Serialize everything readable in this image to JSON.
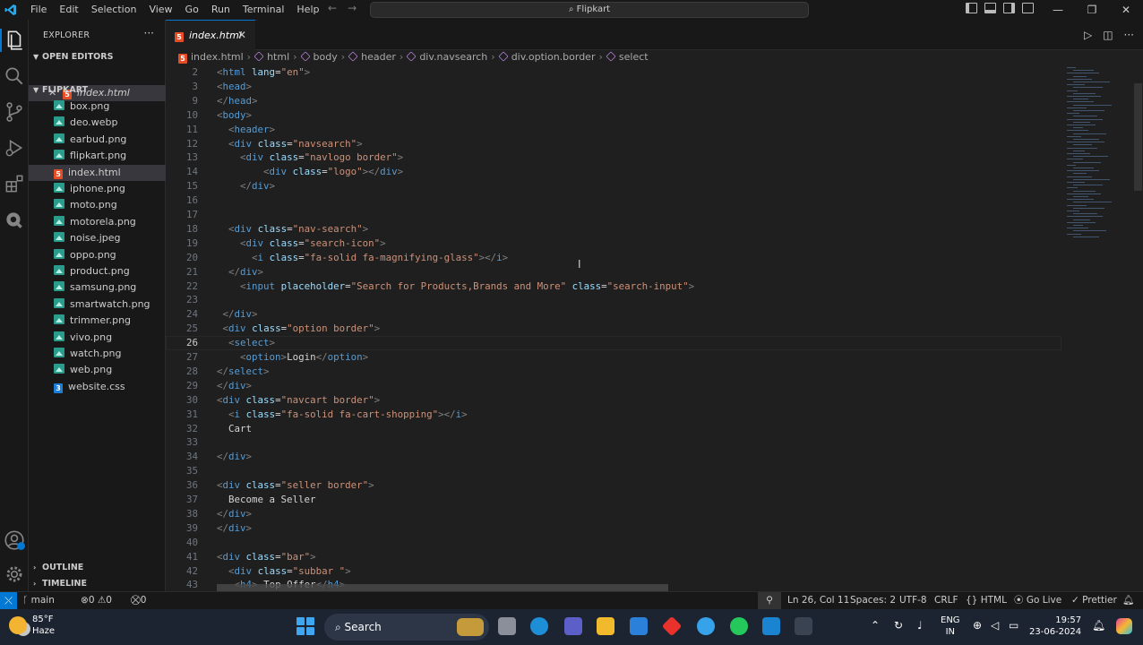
{
  "menu": [
    "File",
    "Edit",
    "Selection",
    "View",
    "Go",
    "Run",
    "Terminal",
    "Help"
  ],
  "command_center": "Flipkart",
  "sidebar": {
    "title": "EXPLORER",
    "open_editors_label": "OPEN EDITORS",
    "open_editor_file": "index.html",
    "folder_label": "FLIPKART",
    "files": [
      {
        "name": "box.png",
        "type": "img"
      },
      {
        "name": "deo.webp",
        "type": "img"
      },
      {
        "name": "earbud.png",
        "type": "img"
      },
      {
        "name": "flipkart.png",
        "type": "img"
      },
      {
        "name": "index.html",
        "type": "html"
      },
      {
        "name": "iphone.png",
        "type": "img"
      },
      {
        "name": "moto.png",
        "type": "img"
      },
      {
        "name": "motorela.png",
        "type": "img"
      },
      {
        "name": "noise.jpeg",
        "type": "img"
      },
      {
        "name": "oppo.png",
        "type": "img"
      },
      {
        "name": "product.png",
        "type": "img"
      },
      {
        "name": "samsung.png",
        "type": "img"
      },
      {
        "name": "smartwatch.png",
        "type": "img"
      },
      {
        "name": "trimmer.png",
        "type": "img"
      },
      {
        "name": "vivo.png",
        "type": "img"
      },
      {
        "name": "watch.png",
        "type": "img"
      },
      {
        "name": "web.png",
        "type": "img"
      },
      {
        "name": "website.css",
        "type": "css"
      }
    ],
    "outline_label": "OUTLINE",
    "timeline_label": "TIMELINE"
  },
  "tab": {
    "label": "index.html"
  },
  "breadcrumb": [
    "index.html",
    "html",
    "body",
    "header",
    "div.navsearch",
    "div.option.border",
    "select"
  ],
  "code_lines": [
    {
      "n": "2",
      "html": "<span class='t'>&lt;</span><span class='tag'>html</span> <span class='at'>lang</span><span class='tx'>=</span><span class='st'>\"en\"</span><span class='t'>&gt;</span>"
    },
    {
      "n": "3",
      "html": "<span class='t'>&lt;</span><span class='tag'>head</span><span class='t'>&gt;</span>"
    },
    {
      "n": "9",
      "html": "<span class='t'>&lt;/</span><span class='tag'>head</span><span class='t'>&gt;</span>"
    },
    {
      "n": "10",
      "html": "<span class='t'>&lt;</span><span class='tag'>body</span><span class='t'>&gt;</span>"
    },
    {
      "n": "11",
      "html": "  <span class='t'>&lt;</span><span class='tag'>header</span><span class='t'>&gt;</span>"
    },
    {
      "n": "12",
      "html": "  <span class='t'>&lt;</span><span class='tag'>div</span> <span class='at'>class</span><span class='tx'>=</span><span class='st'>\"navsearch\"</span><span class='t'>&gt;</span>"
    },
    {
      "n": "13",
      "html": "    <span class='t'>&lt;</span><span class='tag'>div</span> <span class='at'>class</span><span class='tx'>=</span><span class='st'>\"navlogo border\"</span><span class='t'>&gt;</span>"
    },
    {
      "n": "14",
      "html": "        <span class='t'>&lt;</span><span class='tag'>div</span> <span class='at'>class</span><span class='tx'>=</span><span class='st'>\"logo\"</span><span class='t'>&gt;&lt;/</span><span class='tag'>div</span><span class='t'>&gt;</span>"
    },
    {
      "n": "15",
      "html": "    <span class='t'>&lt;/</span><span class='tag'>div</span><span class='t'>&gt;</span>"
    },
    {
      "n": "16",
      "html": ""
    },
    {
      "n": "17",
      "html": ""
    },
    {
      "n": "18",
      "html": "  <span class='t'>&lt;</span><span class='tag'>div</span> <span class='at'>class</span><span class='tx'>=</span><span class='st'>\"nav-search\"</span><span class='t'>&gt;</span>"
    },
    {
      "n": "19",
      "html": "    <span class='t'>&lt;</span><span class='tag'>div</span> <span class='at'>class</span><span class='tx'>=</span><span class='st'>\"search-icon\"</span><span class='t'>&gt;</span>"
    },
    {
      "n": "20",
      "html": "      <span class='t'>&lt;</span><span class='tag'>i</span> <span class='at'>class</span><span class='tx'>=</span><span class='st'>\"fa-solid fa-magnifying-glass\"</span><span class='t'>&gt;&lt;/</span><span class='tag'>i</span><span class='t'>&gt;</span>"
    },
    {
      "n": "21",
      "html": "  <span class='t'>&lt;/</span><span class='tag'>div</span><span class='t'>&gt;</span>"
    },
    {
      "n": "22",
      "html": "    <span class='t'>&lt;</span><span class='tag'>input</span> <span class='at'>placeholder</span><span class='tx'>=</span><span class='st'>\"Search for Products,Brands and More\"</span> <span class='at'>class</span><span class='tx'>=</span><span class='st'>\"search-input\"</span><span class='t'>&gt;</span>"
    },
    {
      "n": "23",
      "html": ""
    },
    {
      "n": "24",
      "html": " <span class='t'>&lt;/</span><span class='tag'>div</span><span class='t'>&gt;</span>"
    },
    {
      "n": "25",
      "html": " <span class='t'>&lt;</span><span class='tag'>div</span> <span class='at'>class</span><span class='tx'>=</span><span class='st'>\"option border\"</span><span class='t'>&gt;</span>"
    },
    {
      "n": "26",
      "html": "  <span class='t'>&lt;</span><span class='tag'>select</span><span class='t'>&gt;</span>"
    },
    {
      "n": "27",
      "html": "    <span class='t'>&lt;</span><span class='tag'>option</span><span class='t'>&gt;</span><span class='tx'>Login</span><span class='t'>&lt;/</span><span class='tag'>option</span><span class='t'>&gt;</span>"
    },
    {
      "n": "28",
      "html": "<span class='t'>&lt;/</span><span class='tag'>select</span><span class='t'>&gt;</span>"
    },
    {
      "n": "29",
      "html": "<span class='t'>&lt;/</span><span class='tag'>div</span><span class='t'>&gt;</span>"
    },
    {
      "n": "30",
      "html": "<span class='t'>&lt;</span><span class='tag'>div</span> <span class='at'>class</span><span class='tx'>=</span><span class='st'>\"navcart border\"</span><span class='t'>&gt;</span>"
    },
    {
      "n": "31",
      "html": "  <span class='t'>&lt;</span><span class='tag'>i</span> <span class='at'>class</span><span class='tx'>=</span><span class='st'>\"fa-solid fa-cart-shopping\"</span><span class='t'>&gt;&lt;/</span><span class='tag'>i</span><span class='t'>&gt;</span>"
    },
    {
      "n": "32",
      "html": "  <span class='tx'>Cart</span>"
    },
    {
      "n": "33",
      "html": ""
    },
    {
      "n": "34",
      "html": "<span class='t'>&lt;/</span><span class='tag'>div</span><span class='t'>&gt;</span>"
    },
    {
      "n": "35",
      "html": ""
    },
    {
      "n": "36",
      "html": "<span class='t'>&lt;</span><span class='tag'>div</span> <span class='at'>class</span><span class='tx'>=</span><span class='st'>\"seller border\"</span><span class='t'>&gt;</span>"
    },
    {
      "n": "37",
      "html": "  <span class='tx'>Become a Seller</span>"
    },
    {
      "n": "38",
      "html": "<span class='t'>&lt;/</span><span class='tag'>div</span><span class='t'>&gt;</span>"
    },
    {
      "n": "39",
      "html": "<span class='t'>&lt;/</span><span class='tag'>div</span><span class='t'>&gt;</span>"
    },
    {
      "n": "40",
      "html": ""
    },
    {
      "n": "41",
      "html": "<span class='t'>&lt;</span><span class='tag'>div</span> <span class='at'>class</span><span class='tx'>=</span><span class='st'>\"bar\"</span><span class='t'>&gt;</span>"
    },
    {
      "n": "42",
      "html": "  <span class='t'>&lt;</span><span class='tag'>div</span> <span class='at'>class</span><span class='tx'>=</span><span class='st'>\"subbar \"</span><span class='t'>&gt;</span>"
    },
    {
      "n": "43",
      "html": "   <span class='t'>&lt;</span><span class='tag'>h4</span><span class='t'>&gt;</span> <span class='tx'>Top Offer</span><span class='t'>&lt;/</span><span class='tag'>h4</span><span class='t'>&gt;</span>"
    }
  ],
  "current_line": "26",
  "statusbar": {
    "branch": "main",
    "errors": "0",
    "warnings": "0",
    "ports": "0",
    "position": "Ln 26, Col 11",
    "spaces": "Spaces: 2",
    "encoding": "UTF-8",
    "eol": "CRLF",
    "language": "HTML",
    "golive": "Go Live",
    "prettier": "Prettier"
  },
  "taskbar": {
    "temp": "85°F",
    "condition": "Haze",
    "search": "Search",
    "lang1": "ENG",
    "lang2": "IN",
    "time": "19:57",
    "date": "23-06-2024"
  }
}
